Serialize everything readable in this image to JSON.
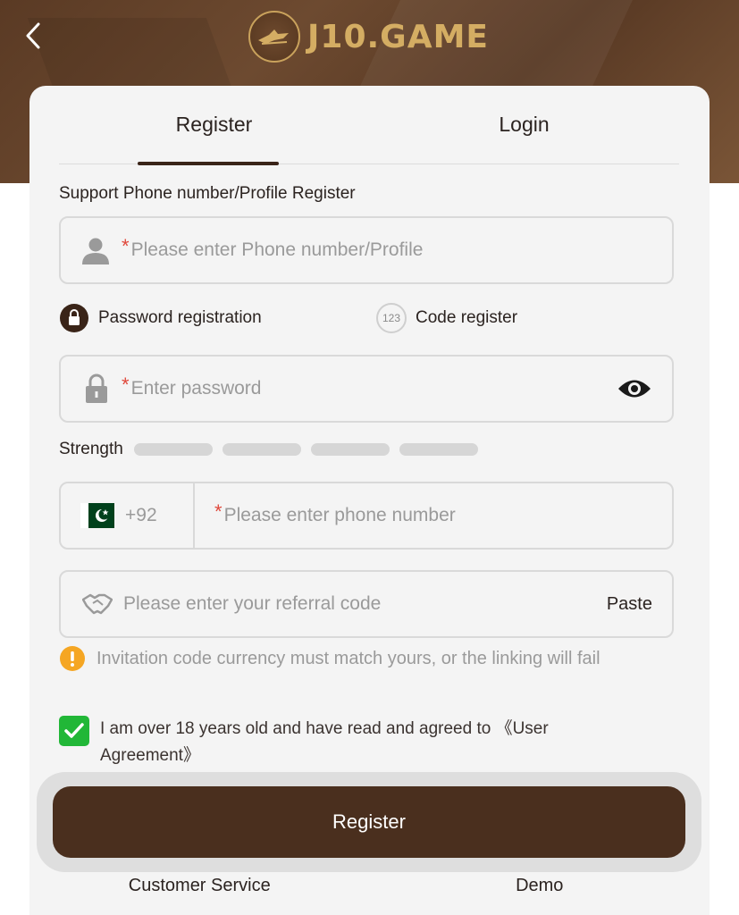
{
  "header": {
    "logo_text": "J10.GAME"
  },
  "tabs": [
    {
      "label": "Register",
      "active": true
    },
    {
      "label": "Login",
      "active": false
    }
  ],
  "form": {
    "support_label": "Support Phone number/Profile Register",
    "profile_placeholder": "Please enter Phone number/Profile",
    "required_mark": "*",
    "modes": {
      "password_label": "Password registration",
      "code_label": "Code register",
      "code_icon_text": "123"
    },
    "password_placeholder": "Enter password",
    "strength_label": "Strength",
    "country_code": "+92",
    "phone_placeholder": "Please enter phone number",
    "referral_placeholder": "Please enter your referral code",
    "paste_label": "Paste",
    "notice": "Invitation code currency must match yours, or the linking will fail",
    "agreement": "I am over 18 years old and have read and agreed to 《User Agreement》",
    "agreement_checked": true
  },
  "actions": {
    "register_label": "Register",
    "customer_service_label": "Customer Service",
    "demo_label": "Demo"
  },
  "colors": {
    "brand_brown": "#4a2f1e",
    "gold": "#d4ad63",
    "check_green": "#21b737",
    "warning_orange": "#f5a623",
    "required_red": "#e0483b"
  }
}
